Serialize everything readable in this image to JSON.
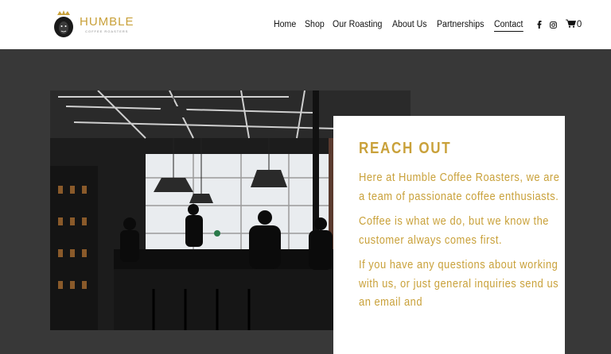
{
  "brand": {
    "name": "HUMBLE",
    "tagline": "COFFEE ROASTERS",
    "accent_color": "#c9a13a"
  },
  "nav": {
    "items": [
      {
        "label": "Home"
      },
      {
        "label": "Shop"
      },
      {
        "label": "Our Roasting"
      },
      {
        "label": "About Us"
      },
      {
        "label": "Partnerships"
      },
      {
        "label": "Contact",
        "active": true
      }
    ],
    "social_icons": [
      "facebook-icon",
      "instagram-icon"
    ],
    "cart_count": "0"
  },
  "hero_image": {
    "description_icon": "cafe-photo"
  },
  "card": {
    "title": "REACH OUT",
    "paragraphs": [
      "Here at Humble Coffee Roasters, we are a team of passionate coffee enthusiasts.",
      "Coffee is what we do, but we know the customer always comes first.",
      "If you have any questions about working with us, or just general inquiries send us an email and"
    ]
  }
}
